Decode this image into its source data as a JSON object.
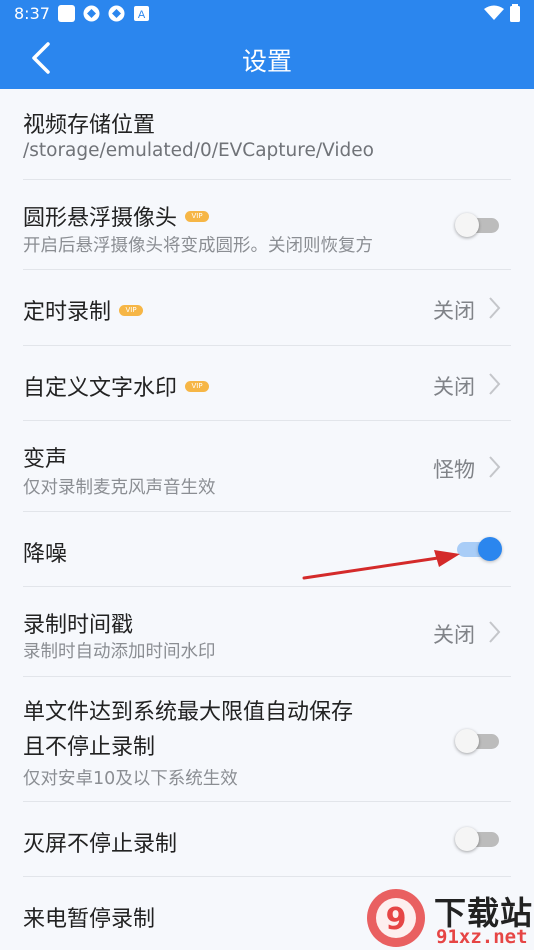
{
  "status_bar": {
    "time": "8:37"
  },
  "app_bar": {
    "title": "设置"
  },
  "settings": [
    {
      "title": "视频存储位置",
      "subtitle": "/storage/emulated/0/EVCapture/Video"
    },
    {
      "title": "圆形悬浮摄像头",
      "vip": "VIP",
      "subtitle": "开启后悬浮摄像头将变成圆形。关闭则恢复方",
      "toggle_on": false
    },
    {
      "title": "定时录制",
      "vip": "VIP",
      "value": "关闭"
    },
    {
      "title": "自定义文字水印",
      "vip": "VIP",
      "value": "关闭"
    },
    {
      "title": "变声",
      "subtitle": "仅对录制麦克风声音生效",
      "value": "怪物"
    },
    {
      "title": "降噪",
      "toggle_on": true
    },
    {
      "title": "录制时间戳",
      "subtitle": "录制时自动添加时间水印",
      "value": "关闭"
    },
    {
      "title_line1": "单文件达到系统最大限值自动保存",
      "title_line2": "且不停止录制",
      "subtitle": "仅对安卓10及以下系统生效",
      "toggle_on": false
    },
    {
      "title": "灭屏不停止录制",
      "toggle_on": false
    },
    {
      "title": "来电暂停录制"
    }
  ],
  "watermark": {
    "text_cn": "下载站",
    "text_url": "91xz.net",
    "badge": "9"
  },
  "colors": {
    "primary": "#2b86ee",
    "vip": "#f6b646",
    "annotation_arrow": "#d42a2a"
  }
}
